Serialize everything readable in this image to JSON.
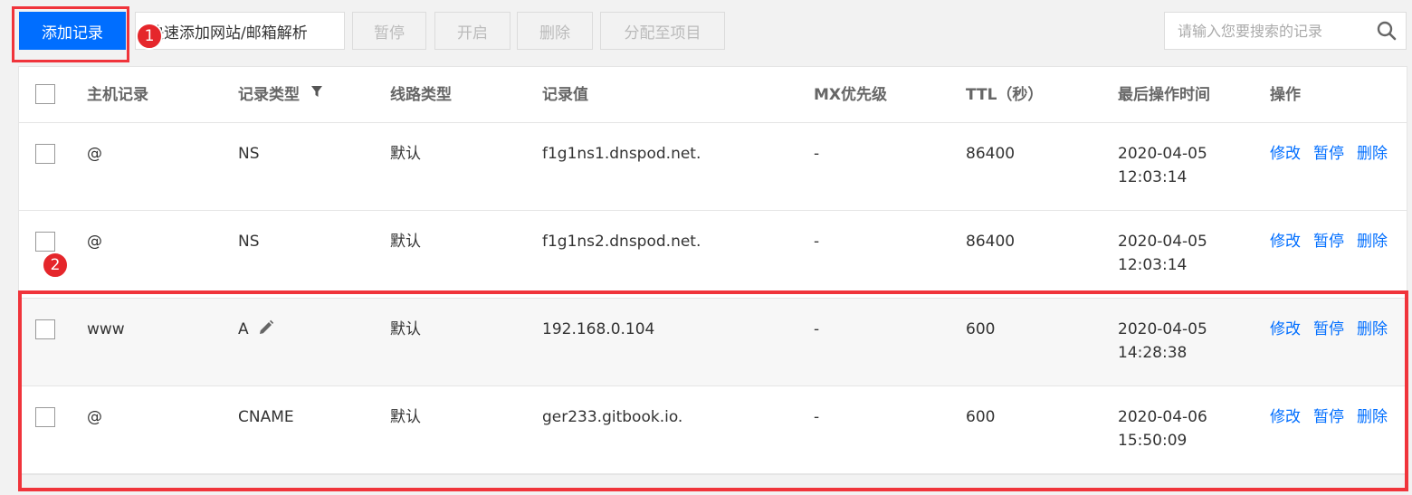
{
  "toolbar": {
    "add_record": "添加记录",
    "quick_add": "快速添加网站/邮箱解析",
    "pause": "暂停",
    "enable": "开启",
    "delete": "删除",
    "assign_project": "分配至项目"
  },
  "search": {
    "placeholder": "请输入您要搜索的记录",
    "value": ""
  },
  "annotations": {
    "badge1": "1",
    "badge2": "2",
    "highlight_color": "#f0343b"
  },
  "table": {
    "headers": {
      "host": "主机记录",
      "type": "记录类型",
      "line": "线路类型",
      "value": "记录值",
      "mx": "MX优先级",
      "ttl": "TTL（秒）",
      "time": "最后操作时间",
      "ops": "操作"
    },
    "rows": [
      {
        "host": "@",
        "type": "NS",
        "line": "默认",
        "value": "f1g1ns1.dnspod.net.",
        "mx": "-",
        "ttl": "86400",
        "date": "2020-04-05",
        "time": "12:03:14",
        "edit": "修改",
        "pause": "暂停",
        "delete": "删除"
      },
      {
        "host": "@",
        "type": "NS",
        "line": "默认",
        "value": "f1g1ns2.dnspod.net.",
        "mx": "-",
        "ttl": "86400",
        "date": "2020-04-05",
        "time": "12:03:14",
        "edit": "修改",
        "pause": "暂停",
        "delete": "删除"
      },
      {
        "host": "www",
        "type": "A",
        "line": "默认",
        "value": "192.168.0.104",
        "mx": "-",
        "ttl": "600",
        "date": "2020-04-05",
        "time": "14:28:38",
        "edit": "修改",
        "pause": "暂停",
        "delete": "删除"
      },
      {
        "host": "@",
        "type": "CNAME",
        "line": "默认",
        "value": "ger233.gitbook.io.",
        "mx": "-",
        "ttl": "600",
        "date": "2020-04-06",
        "time": "15:50:09",
        "edit": "修改",
        "pause": "暂停",
        "delete": "删除"
      }
    ]
  },
  "colors": {
    "primary": "#006eff",
    "link": "#006eff",
    "annotation_red": "#e5262b"
  },
  "icons": {
    "filter": "filter-icon",
    "edit": "pencil-icon",
    "search": "search-icon"
  }
}
